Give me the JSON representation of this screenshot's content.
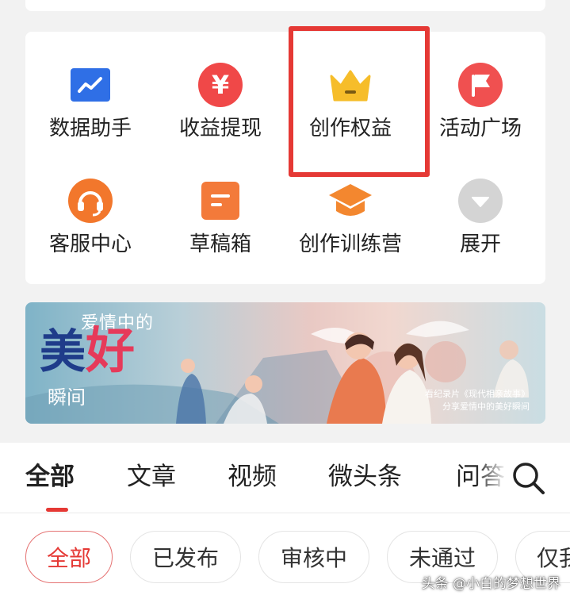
{
  "colors": {
    "accent": "#e53935",
    "data_icon": "#2f6fe6",
    "income_icon": "#f04848",
    "rights_icon": "#f6bd2a",
    "activity_icon": "#f05050",
    "service_icon": "#f2772c",
    "draft_icon": "#f37a3a",
    "training_icon": "#f3872f",
    "expand_icon": "#d4d4d4"
  },
  "grid": {
    "items": [
      {
        "label": "数据助手",
        "icon": "chart-icon"
      },
      {
        "label": "收益提现",
        "icon": "yuan-icon"
      },
      {
        "label": "创作权益",
        "icon": "crown-icon"
      },
      {
        "label": "活动广场",
        "icon": "flag-icon"
      },
      {
        "label": "客服中心",
        "icon": "headset-icon"
      },
      {
        "label": "草稿箱",
        "icon": "draft-icon"
      },
      {
        "label": "创作训练营",
        "icon": "graduation-cap-icon"
      },
      {
        "label": "展开",
        "icon": "chevron-down-icon"
      }
    ],
    "highlighted_item": "创作权益"
  },
  "banner": {
    "small_title": "爱情中的",
    "big_title_1": "美",
    "big_title_2": "好",
    "moment": "瞬间",
    "caption_line1": "看纪录片《现代相亲故事》",
    "caption_line2": "分享爱情中的美好瞬间"
  },
  "tabs": {
    "items": [
      "全部",
      "文章",
      "视频",
      "微头条",
      "问答"
    ],
    "active": "全部"
  },
  "filters": {
    "items": [
      "全部",
      "已发布",
      "审核中",
      "未通过",
      "仅我可见"
    ],
    "active": "全部"
  },
  "watermark": "头条 @小白的梦想世界"
}
